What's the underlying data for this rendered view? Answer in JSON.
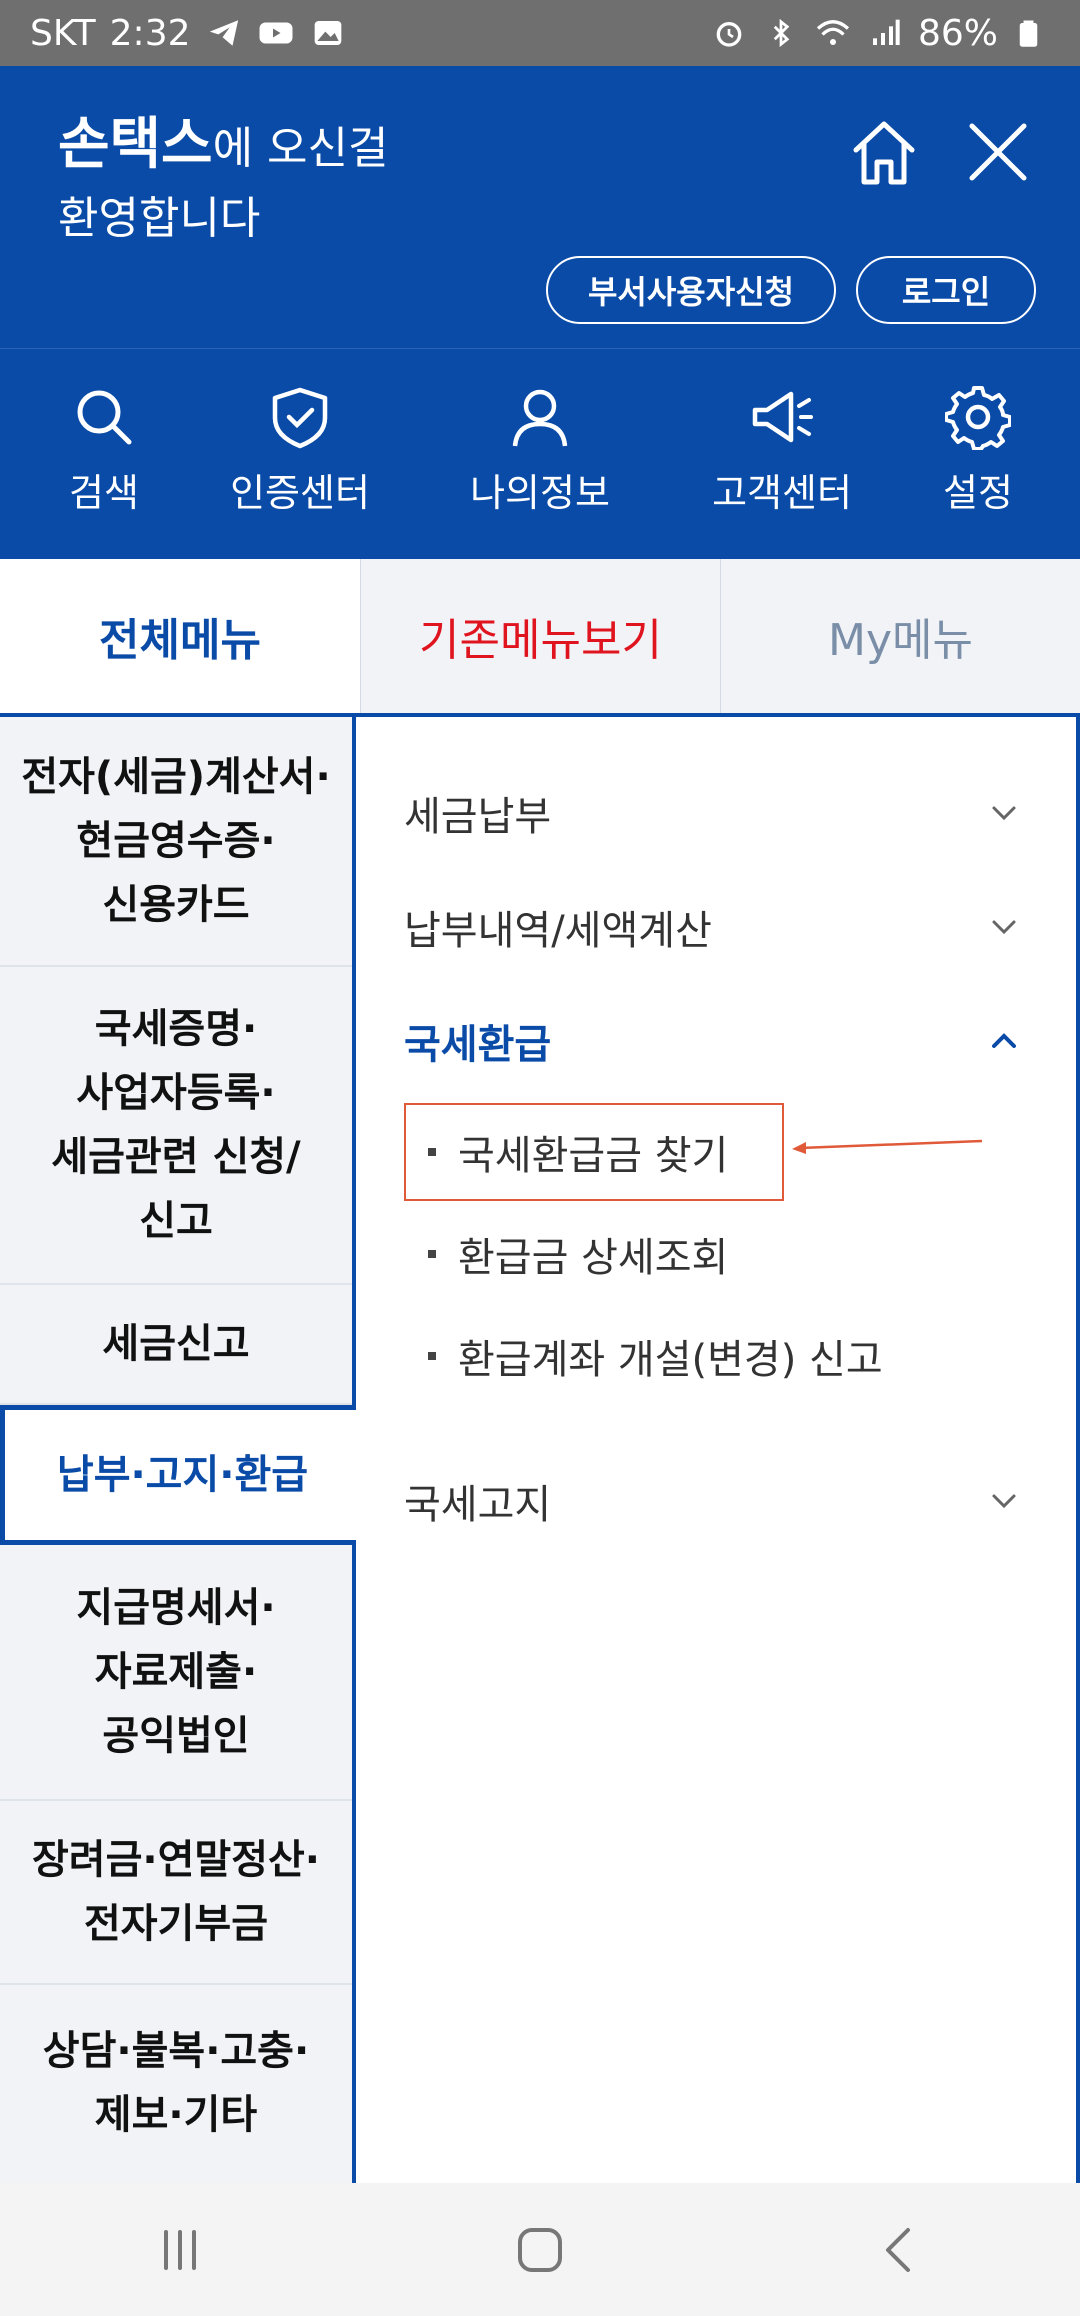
{
  "status_bar": {
    "carrier": "SKT",
    "time": "2:32",
    "battery": "86%"
  },
  "header": {
    "brand": "손택스",
    "welcome_line1_suffix": "에 오신걸",
    "welcome_line2": "환영합니다",
    "btn_dept_user": "부서사용자신청",
    "btn_login": "로그인"
  },
  "quick_menu": [
    {
      "label": "검색",
      "icon": "search-icon"
    },
    {
      "label": "인증센터",
      "icon": "shield-check-icon"
    },
    {
      "label": "나의정보",
      "icon": "person-icon"
    },
    {
      "label": "고객센터",
      "icon": "megaphone-icon"
    },
    {
      "label": "설정",
      "icon": "gear-icon"
    }
  ],
  "tabs": {
    "all": "전체메뉴",
    "legacy": "기존메뉴보기",
    "my": "My메뉴"
  },
  "sidebar": {
    "items": [
      {
        "label": "전자(세금)계산서·\n현금영수증·\n신용카드"
      },
      {
        "label": "국세증명·\n사업자등록·\n세금관련 신청/\n신고"
      },
      {
        "label": "세금신고"
      },
      {
        "label": "납부·고지·환급"
      },
      {
        "label": "지급명세서·\n자료제출·\n공익법인"
      },
      {
        "label": "장려금·연말정산·\n전자기부금"
      },
      {
        "label": "상담·불복·고충·\n제보·기타"
      }
    ],
    "active_index": 3
  },
  "panel": {
    "menus": [
      {
        "label": "세금납부",
        "open": false
      },
      {
        "label": "납부내역/세액계산",
        "open": false
      },
      {
        "label": "국세환급",
        "open": true
      },
      {
        "label": "국세고지",
        "open": false
      }
    ],
    "submenu": [
      {
        "label": "국세환급금 찾기"
      },
      {
        "label": "환급금 상세조회"
      },
      {
        "label": "환급계좌 개설(변경) 신고"
      }
    ],
    "accent_color": "#0a4ba8",
    "highlight_color": "#e05a3a"
  }
}
